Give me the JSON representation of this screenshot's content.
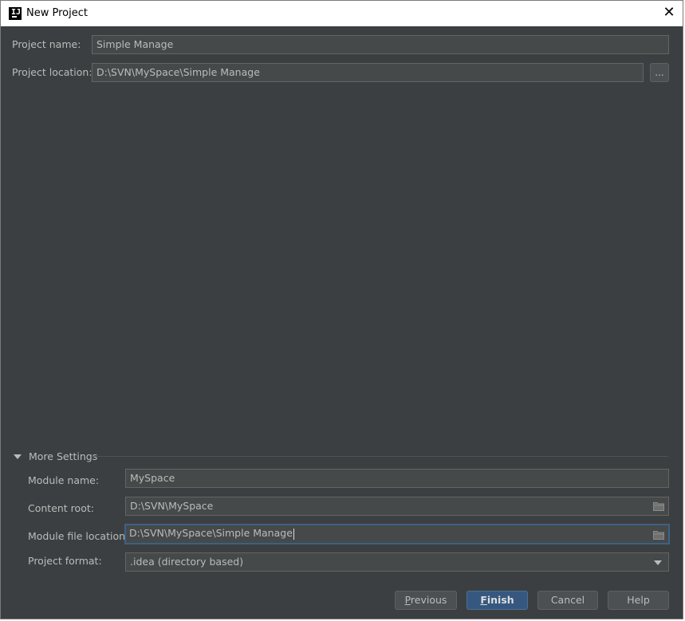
{
  "window": {
    "title": "New Project",
    "app_icon_text": "IJ",
    "close_glyph": "✕"
  },
  "project": {
    "name_label": "Project name:",
    "name_value": "Simple Manage",
    "location_label": "Project location:",
    "location_value": "D:\\SVN\\MySpace\\Simple Manage",
    "browse_label": "..."
  },
  "more_settings": {
    "title": "More Settings",
    "expanded": true,
    "module_name_label": "Module name:",
    "module_name_value": "MySpace",
    "content_root_label": "Content root:",
    "content_root_value": "D:\\SVN\\MySpace",
    "module_file_location_label": "Module file location:",
    "module_file_location_value": "D:\\SVN\\MySpace\\Simple Manage",
    "project_format_label": "Project format:",
    "project_format_value": ".idea (directory based)"
  },
  "buttons": {
    "previous_mnemonic": "P",
    "previous_rest": "revious",
    "finish_mnemonic": "F",
    "finish_rest": "inish",
    "cancel": "Cancel",
    "help": "Help"
  },
  "icons": {
    "folder": "folder-icon",
    "dropdown": "chevron-down-icon",
    "collapse": "triangle-down-icon",
    "close": "close-icon",
    "app": "intellij-icon"
  },
  "colors": {
    "background": "#3c3f41",
    "field_background": "#45494a",
    "text": "#bbbbbb",
    "accent": "#365880",
    "focus_border": "#3d6185"
  }
}
